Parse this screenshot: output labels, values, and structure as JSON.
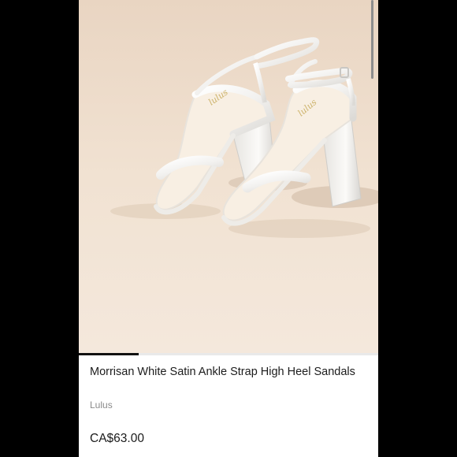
{
  "product": {
    "title": "Morrisan White Satin Ankle Strap High Heel Sandals",
    "brand": "Lulus",
    "price": "CA$63.00",
    "image_alt": "White satin ankle strap block heel sandals",
    "insole_logo": "lulus"
  },
  "gallery": {
    "progress": 0.2
  },
  "colors": {
    "background": "#f1e2d2",
    "shoe": "#f7f6f4",
    "accent": "#111111"
  }
}
